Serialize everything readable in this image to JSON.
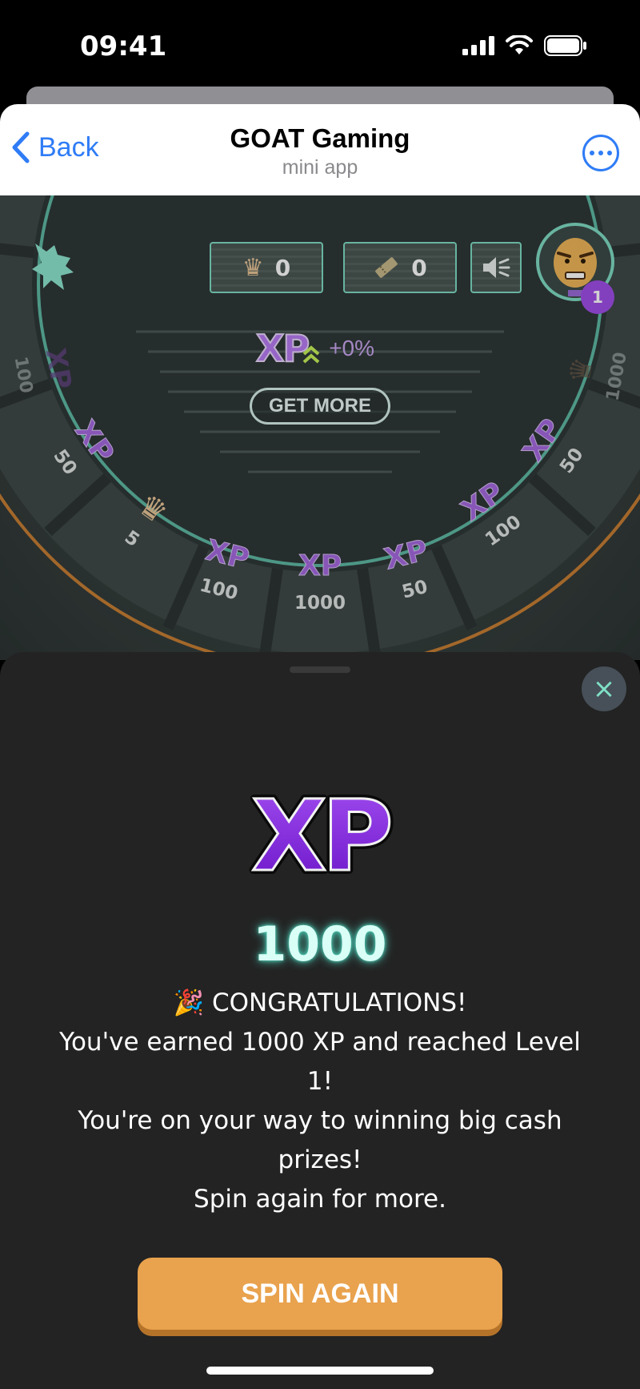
{
  "status_bar": {
    "time": "09:41"
  },
  "header": {
    "back_label": "Back",
    "title": "GOAT Gaming",
    "subtitle": "mini app"
  },
  "game": {
    "crowns_count": "0",
    "tickets_count": "0",
    "level": "1",
    "xp_logo": "XP",
    "boost_text": "+0%",
    "get_more_label": "GET MORE",
    "wheel_segments": [
      {
        "icon": "xp-icon",
        "label": "XP",
        "value": "100"
      },
      {
        "icon": "xp-icon",
        "label": "XP",
        "value": "50"
      },
      {
        "icon": "crown-icon",
        "label": "",
        "value": "5"
      },
      {
        "icon": "xp-icon",
        "label": "XP",
        "value": "100"
      },
      {
        "icon": "xp-icon",
        "label": "XP",
        "value": "1000"
      },
      {
        "icon": "xp-icon",
        "label": "XP",
        "value": "50"
      },
      {
        "icon": "xp-icon",
        "label": "XP",
        "value": "100"
      },
      {
        "icon": "xp-icon",
        "label": "XP",
        "value": "50"
      },
      {
        "icon": "crown-icon",
        "label": "",
        "value": "1000"
      }
    ]
  },
  "reward": {
    "big_xp": "XP",
    "amount": "1000",
    "line1": "🎉 CONGRATULATIONS!",
    "line2": "You've earned 1000 XP and reached Level 1!",
    "line3": "You're on your way to winning big cash prizes!",
    "line4": "Spin again for more.",
    "spin_again_label": "SPIN AGAIN",
    "close_icon": "×"
  },
  "colors": {
    "accent_blue": "#2f7cf6",
    "teal": "#7fdcc4",
    "purple": "#8a2be2",
    "orange_button": "#e9a24d",
    "sheet_bg": "#232323"
  }
}
